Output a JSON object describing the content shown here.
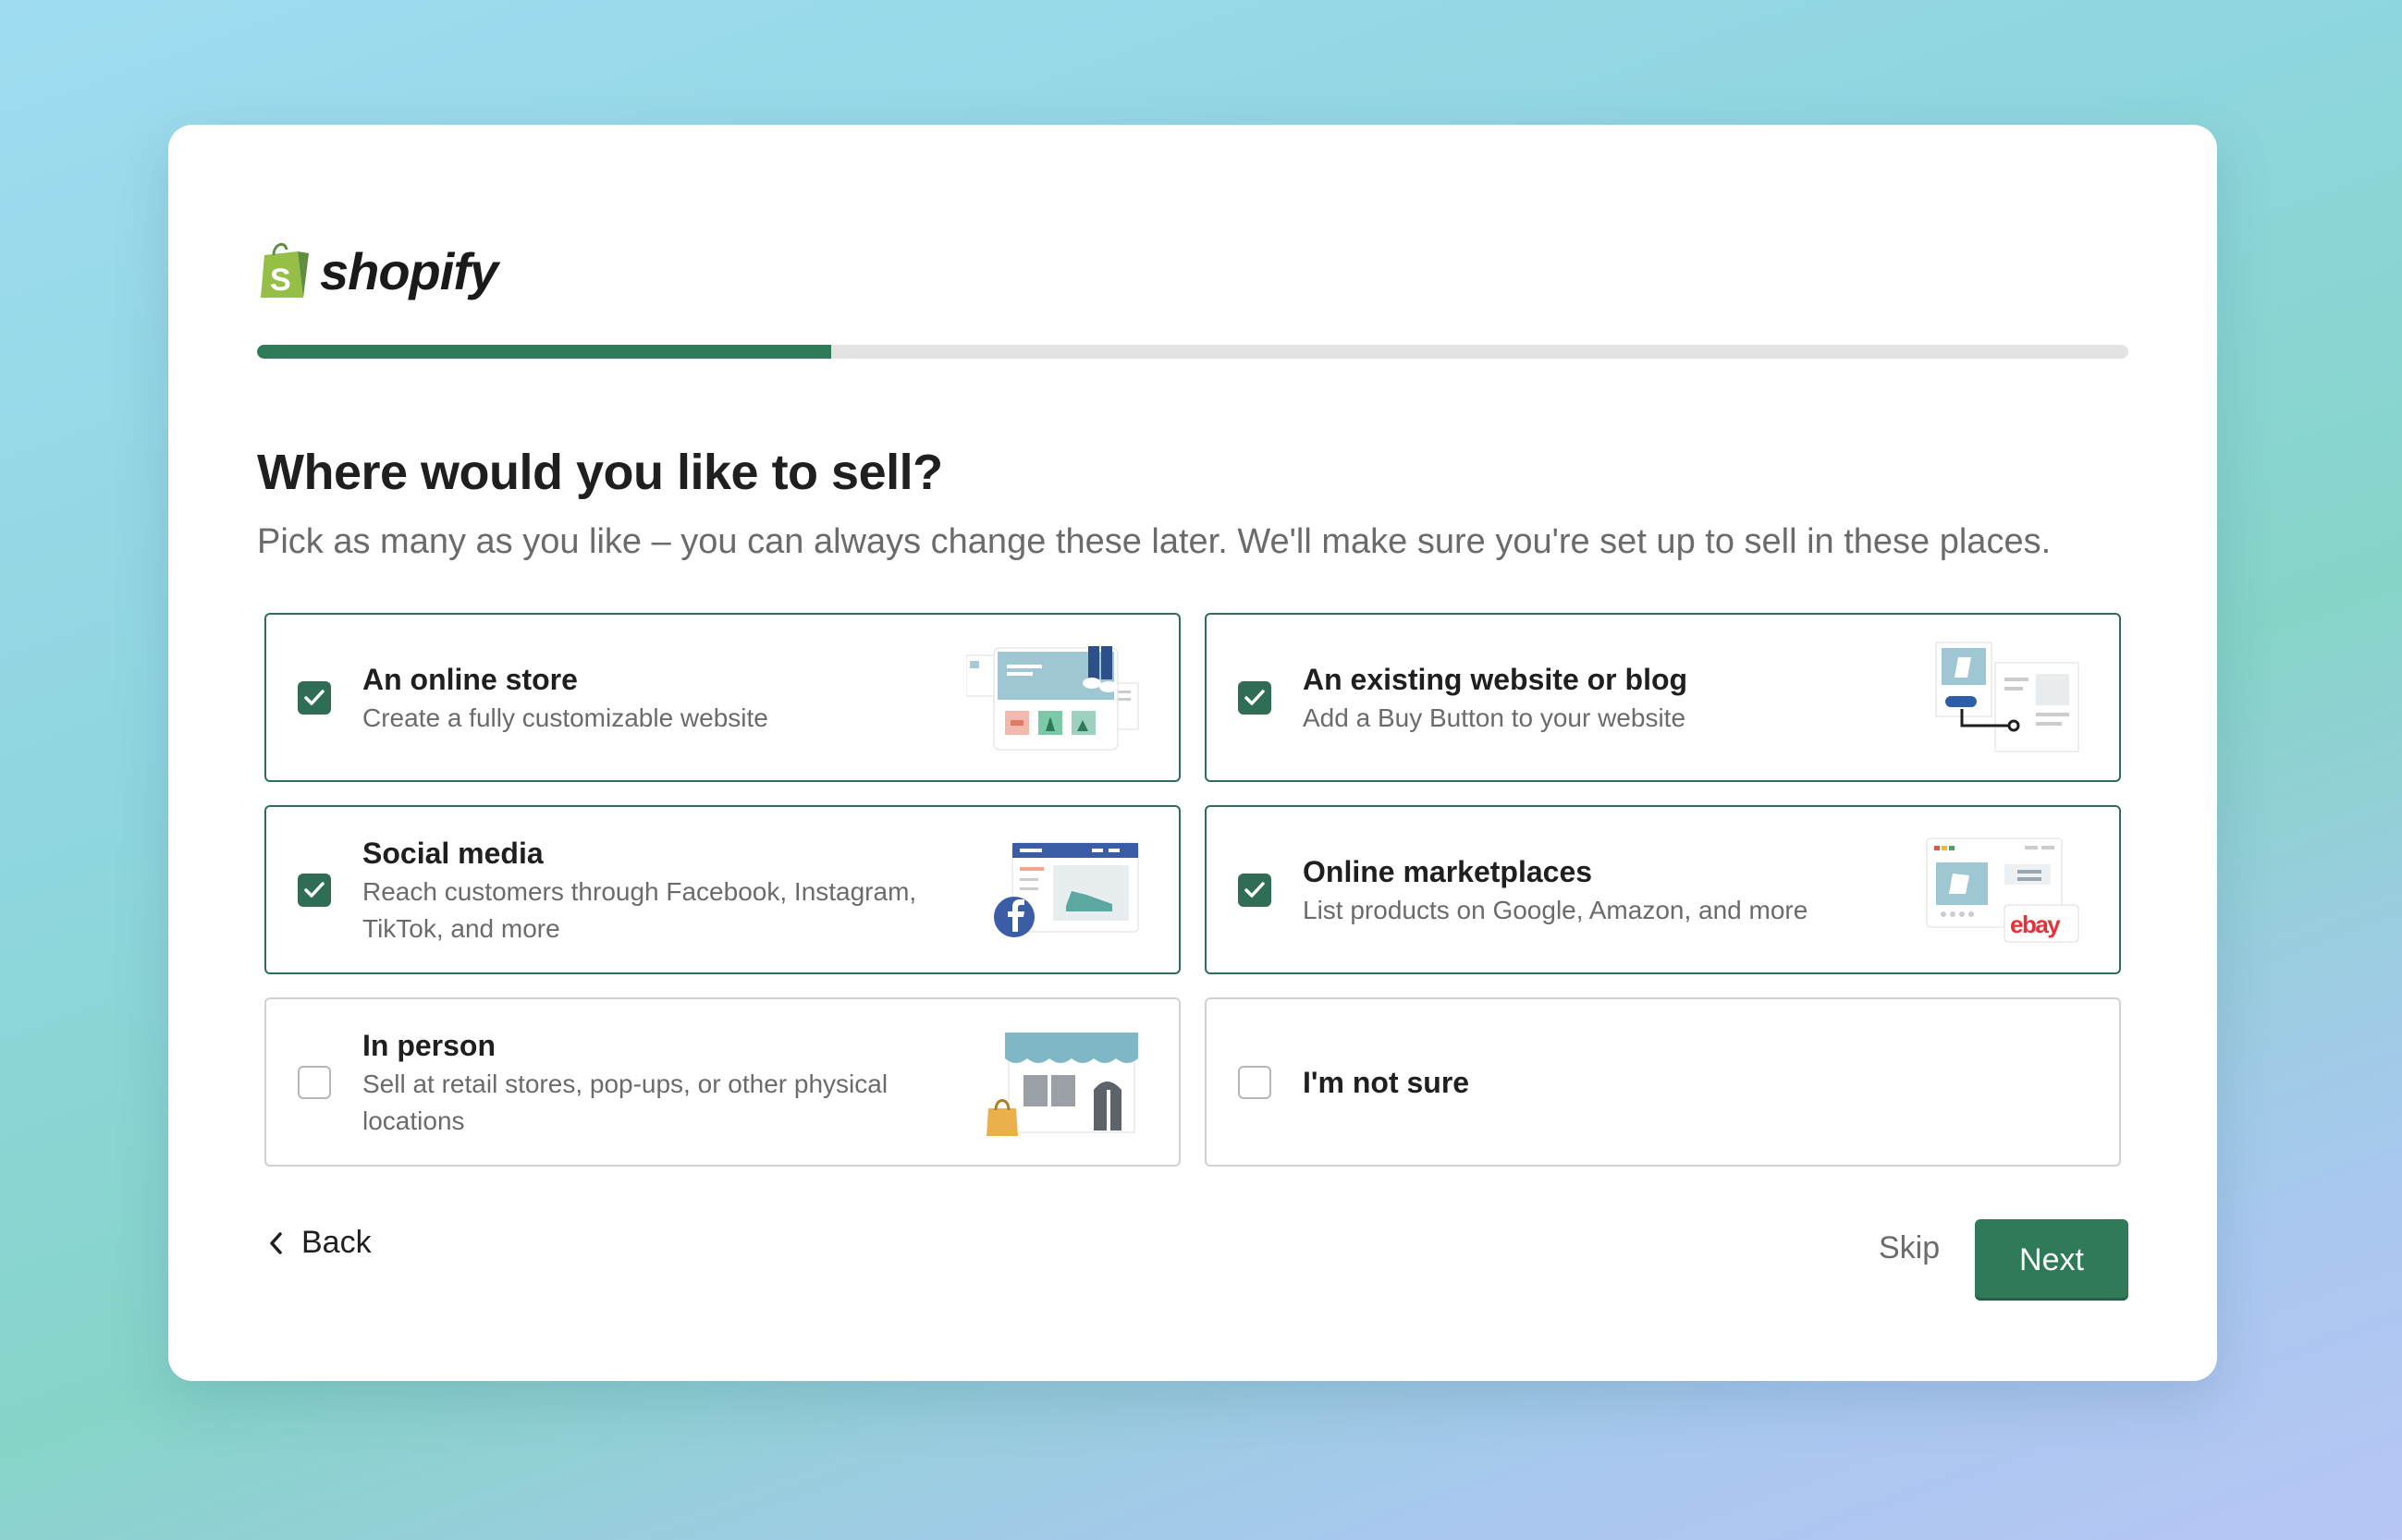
{
  "brand": {
    "name": "shopify",
    "bag_letter": "S"
  },
  "progress": {
    "fraction": 0.307
  },
  "heading": "Where would you like to sell?",
  "subheading": "Pick as many as you like – you can always change these later. We'll make sure you're set up to sell in these places.",
  "options": [
    {
      "title": "An online store",
      "desc": "Create a fully customizable website",
      "checked": true,
      "icon": "online-store-illustration"
    },
    {
      "title": "An existing website or blog",
      "desc": "Add a Buy Button to your website",
      "checked": true,
      "icon": "buy-button-illustration"
    },
    {
      "title": "Social media",
      "desc": "Reach customers through Facebook, Instagram, TikTok, and more",
      "checked": true,
      "icon": "social-media-illustration"
    },
    {
      "title": "Online marketplaces",
      "desc": "List products on Google, Amazon, and more",
      "checked": true,
      "icon": "marketplaces-illustration",
      "badge": "ebay"
    },
    {
      "title": "In person",
      "desc": "Sell at retail stores, pop-ups, or other physical locations",
      "checked": false,
      "icon": "storefront-illustration"
    },
    {
      "title": "I'm not sure",
      "desc": "",
      "checked": false
    }
  ],
  "footer": {
    "back_label": "Back",
    "skip_label": "Skip",
    "next_label": "Next"
  },
  "colors": {
    "primary": "#2f7a58",
    "border_selected": "#2f6d55",
    "border_unselected": "#cfd2d4"
  }
}
